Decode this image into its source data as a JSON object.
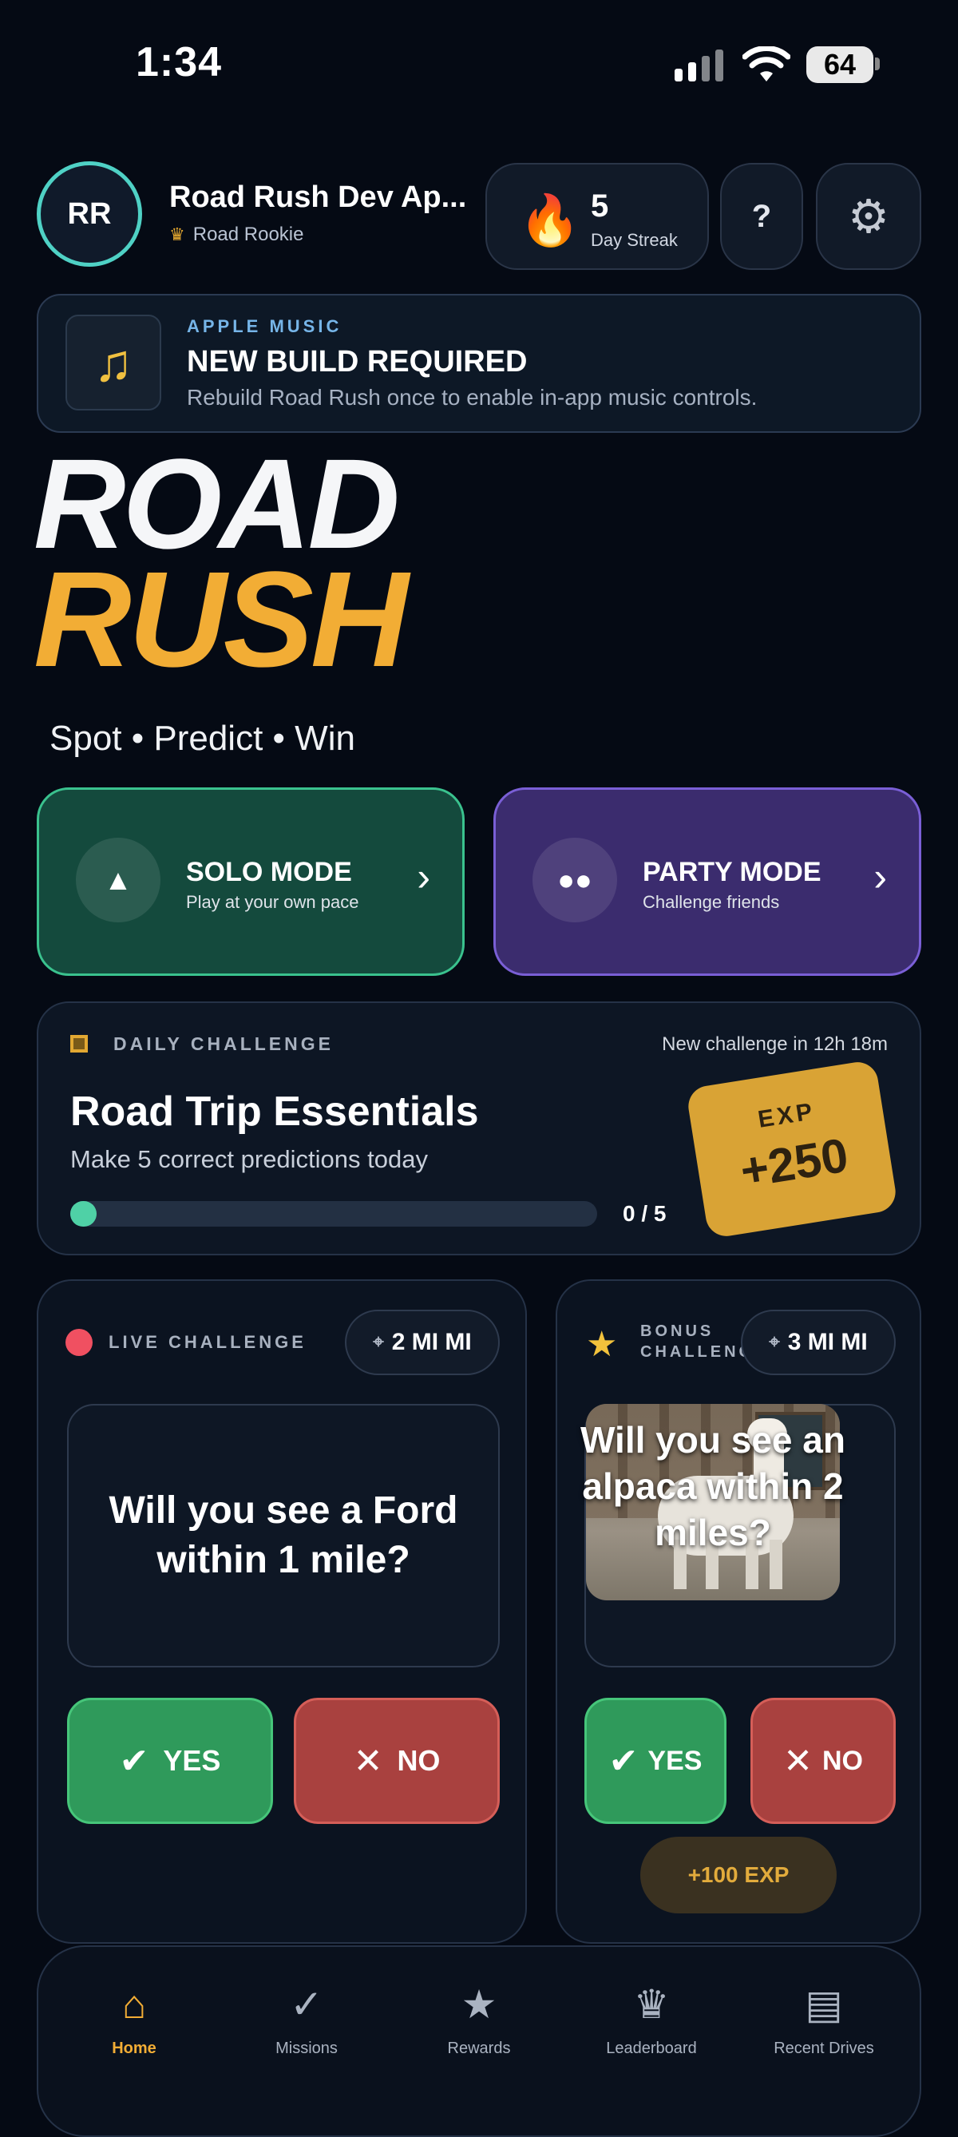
{
  "status_bar": {
    "time": "1:34",
    "battery": "64"
  },
  "header": {
    "avatar_initials": "RR",
    "user_name": "Road Rush Dev Ap...",
    "rank": "Road Rookie",
    "streak_count": "5",
    "streak_label": "Day Streak",
    "help_label": "?"
  },
  "music_banner": {
    "kicker": "APPLE MUSIC",
    "title": "NEW BUILD REQUIRED",
    "subtitle": "Rebuild Road Rush once to enable in-app music controls."
  },
  "logo": {
    "line1": "ROAD",
    "line2": "RUSH"
  },
  "tagline": "Spot • Predict • Win",
  "modes": {
    "solo": {
      "title": "SOLO MODE",
      "subtitle": "Play at your own pace"
    },
    "party": {
      "title": "PARTY MODE",
      "subtitle": "Challenge friends"
    }
  },
  "daily_challenge": {
    "kicker": "DAILY CHALLENGE",
    "timer": "New challenge in 12h 18m",
    "title": "Road Trip Essentials",
    "subtitle": "Make 5 correct predictions today",
    "progress_text": "0 / 5",
    "progress_fraction": 0.05,
    "exp_label": "EXP",
    "exp_value": "+250"
  },
  "live_challenge": {
    "kicker": "LIVE CHALLENGE",
    "distance": "2 MI MI",
    "question": "Will you see a Ford within 1 mile?",
    "yes_label": "YES",
    "no_label": "NO"
  },
  "bonus_challenge": {
    "kicker_line1": "BONUS",
    "kicker_line2": "CHALLENGE",
    "distance": "3 MI MI",
    "question": "Will you see an alpaca within 2 miles?",
    "yes_label": "YES",
    "no_label": "NO",
    "exp_reward": "+100 EXP"
  },
  "nav": [
    {
      "label": "Home",
      "icon": "home-icon",
      "active": true
    },
    {
      "label": "Missions",
      "icon": "check-icon"
    },
    {
      "label": "Rewards",
      "icon": "star-icon"
    },
    {
      "label": "Leaderboard",
      "icon": "crown-icon"
    },
    {
      "label": "Recent Drives",
      "icon": "list-icon"
    }
  ],
  "colors": {
    "background": "#050a14",
    "accent_gold": "#f2ad35",
    "solo_green": "#144a3d",
    "party_purple": "#3b2c6e",
    "yes_green": "#2f9a5b",
    "no_red": "#a9413f",
    "teal": "#4fd1c5"
  }
}
